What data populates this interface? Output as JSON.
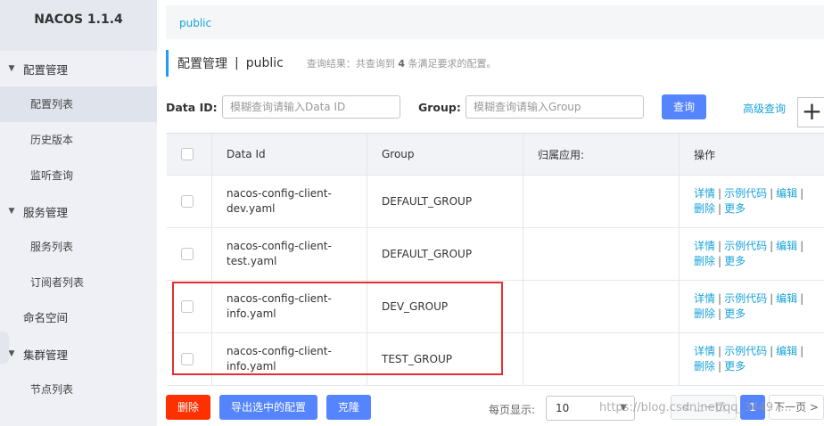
{
  "app": {
    "title": "NACOS 1.1.4"
  },
  "sidebar": {
    "groups": [
      {
        "label": "配置管理",
        "items": [
          "配置列表",
          "历史版本",
          "监听查询"
        ]
      },
      {
        "label": "服务管理",
        "items": [
          "服务列表",
          "订阅者列表"
        ]
      },
      {
        "label": "命名空间"
      },
      {
        "label": "集群管理",
        "items": [
          "节点列表"
        ]
      }
    ],
    "active_item": "配置列表"
  },
  "namespace_tab": "public",
  "header": {
    "title": "配置管理",
    "separator": "|",
    "namespace": "public",
    "query_result_prefix": "查询结果：共查询到",
    "query_result_count": "4",
    "query_result_suffix": "条满足要求的配置。"
  },
  "search": {
    "dataid_label": "Data ID:",
    "dataid_placeholder": "模糊查询请输入Data ID",
    "group_label": "Group:",
    "group_placeholder": "模糊查询请输入Group",
    "query_button": "查询",
    "advanced_link": "高级查询",
    "add_button": "+"
  },
  "table": {
    "columns": [
      "Data Id",
      "Group",
      "归属应用:",
      "操作"
    ],
    "rows": [
      {
        "data_id_1": "nacos-config-client-",
        "data_id_2": "dev.yaml",
        "group": "DEFAULT_GROUP",
        "app": ""
      },
      {
        "data_id_1": "nacos-config-client-",
        "data_id_2": "test.yaml",
        "group": "DEFAULT_GROUP",
        "app": ""
      },
      {
        "data_id_1": "nacos-config-client-",
        "data_id_2": "info.yaml",
        "group": "DEV_GROUP",
        "app": ""
      },
      {
        "data_id_1": "nacos-config-client-",
        "data_id_2": "info.yaml",
        "group": "TEST_GROUP",
        "app": ""
      }
    ],
    "actions": {
      "detail": "详情",
      "sample_code": "示例代码",
      "edit": "编辑",
      "delete": "删除",
      "more": "更多",
      "separator": "|"
    }
  },
  "footer": {
    "delete_button": "删除",
    "export_button": "导出选中的配置",
    "clone_button": "克隆",
    "page_size_label": "每页显示:",
    "page_size": "10",
    "prev": "< 上一页",
    "current_page": "1",
    "next": "下一页 >"
  },
  "watermark": "https://blog.csdn.net/qq_34497...",
  "colors": {
    "accent": "#5584ff",
    "link": "#1aa3d9",
    "danger": "#ff3000",
    "highlight": "#e2302e"
  }
}
